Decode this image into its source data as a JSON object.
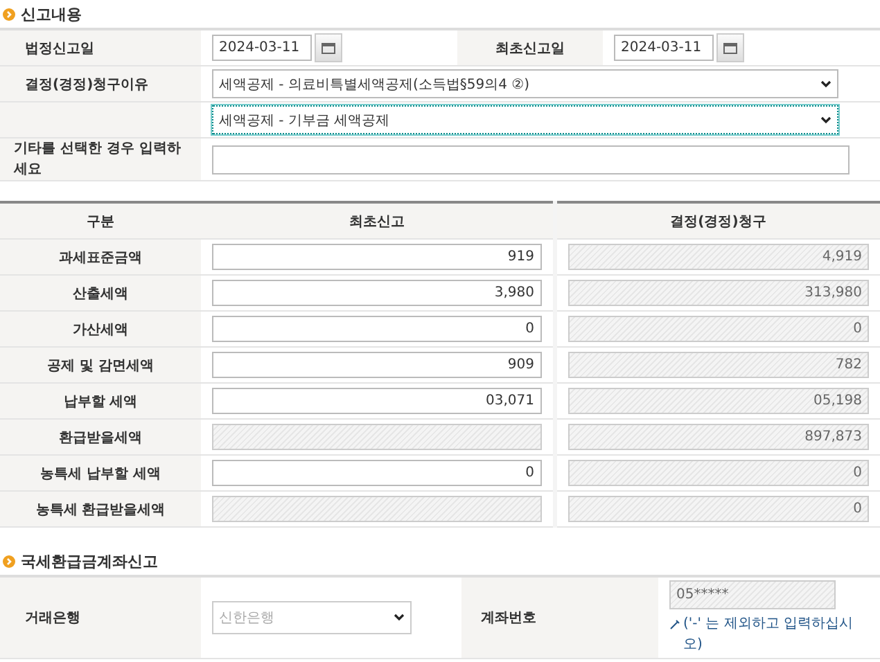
{
  "report_section": {
    "title": "신고내용",
    "statutory_date": {
      "label": "법정신고일",
      "value": "2024-03-11"
    },
    "initial_date": {
      "label": "최초신고일",
      "value": "2024-03-11"
    },
    "reason": {
      "label": "결정(경정)청구이유",
      "selects": [
        {
          "value": "세액공제 - 의료비특별세액공제(소득법§59의4 ②)",
          "focused": false
        },
        {
          "value": "세액공제 - 기부금 세액공제",
          "focused": true
        }
      ]
    },
    "other": {
      "label": "기타를 선택한 경우 입력하세요"
    }
  },
  "amounts": {
    "columns": [
      "구분",
      "최초신고",
      "결정(경정)청구"
    ],
    "rows": [
      {
        "label": "과세표준금액",
        "initial": {
          "value": "919",
          "disabled": false
        },
        "claim": {
          "value": "4,919",
          "disabled": true
        }
      },
      {
        "label": "산출세액",
        "initial": {
          "value": "3,980",
          "disabled": false
        },
        "claim": {
          "value": "313,980",
          "disabled": true
        }
      },
      {
        "label": "가산세액",
        "initial": {
          "value": "0",
          "disabled": false
        },
        "claim": {
          "value": "0",
          "disabled": true
        }
      },
      {
        "label": "공제 및 감면세액",
        "initial": {
          "value": "909",
          "disabled": false
        },
        "claim": {
          "value": "782",
          "disabled": true
        }
      },
      {
        "label": "납부할 세액",
        "initial": {
          "value": "03,071",
          "disabled": false
        },
        "claim": {
          "value": "05,198",
          "disabled": true
        }
      },
      {
        "label": "환급받을세액",
        "initial": {
          "disabled": true
        },
        "claim": {
          "value": "897,873",
          "disabled": true
        }
      },
      {
        "label": "농특세 납부할 세액",
        "initial": {
          "value": "0",
          "disabled": false
        },
        "claim": {
          "value": "0",
          "disabled": true
        }
      },
      {
        "label": "농특세 환급받을세액",
        "initial": {
          "disabled": true
        },
        "claim": {
          "value": "0",
          "disabled": true
        }
      }
    ]
  },
  "refund_section": {
    "title": "국세환급금계좌신고",
    "bank": {
      "label": "거래은행",
      "value": "신한은행",
      "disabled": true
    },
    "account": {
      "label": "계좌번호",
      "value": "05*****",
      "disabled": true,
      "note": "('-' 는 제외하고 입력하십시오)"
    }
  }
}
